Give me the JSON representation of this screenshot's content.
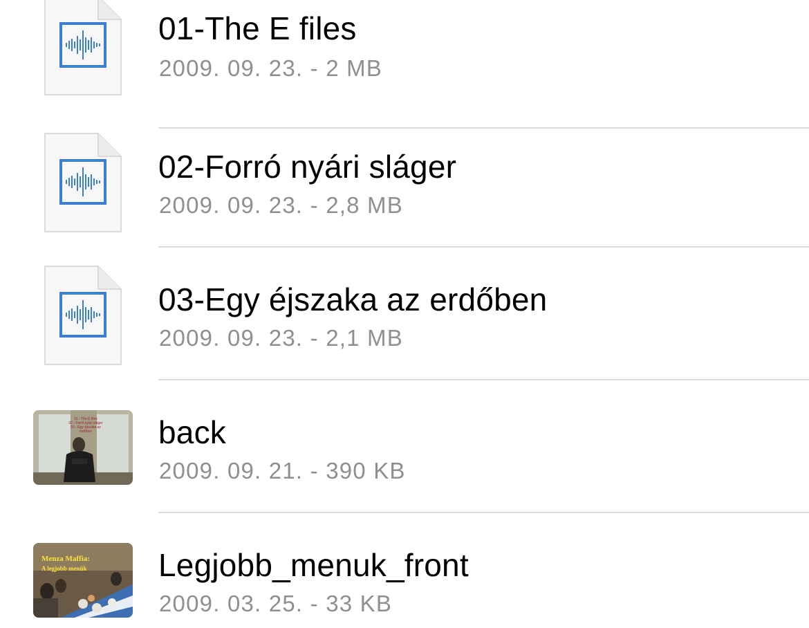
{
  "files": [
    {
      "name": "01-The E files",
      "meta": "2009. 09. 23. - 2 MB",
      "icon": "audio-file-icon"
    },
    {
      "name": "02-Forró nyári sláger",
      "meta": "2009. 09. 23. - 2,8 MB",
      "icon": "audio-file-icon"
    },
    {
      "name": "03-Egy éjszaka az erdőben",
      "meta": "2009. 09. 23. - 2,1 MB",
      "icon": "audio-file-icon"
    },
    {
      "name": "back",
      "meta": "2009. 09. 21. - 390 KB",
      "icon": "image-thumbnail"
    },
    {
      "name": "Legjobb_menuk_front",
      "meta": "2009. 03. 25. - 33 KB",
      "icon": "image-thumbnail"
    }
  ],
  "thumbnails": {
    "back": {
      "text": [
        "01 - The E files",
        "02 - Forró nyári sláger",
        "03 - Egy éjszaka az erdőben"
      ]
    },
    "front": {
      "text": [
        "Menza Maffia:",
        "A legjobb menük"
      ]
    }
  },
  "colors": {
    "accent": "#3a7fd5",
    "secondary_text": "#8e8e93",
    "separator": "#dcdcdf"
  }
}
